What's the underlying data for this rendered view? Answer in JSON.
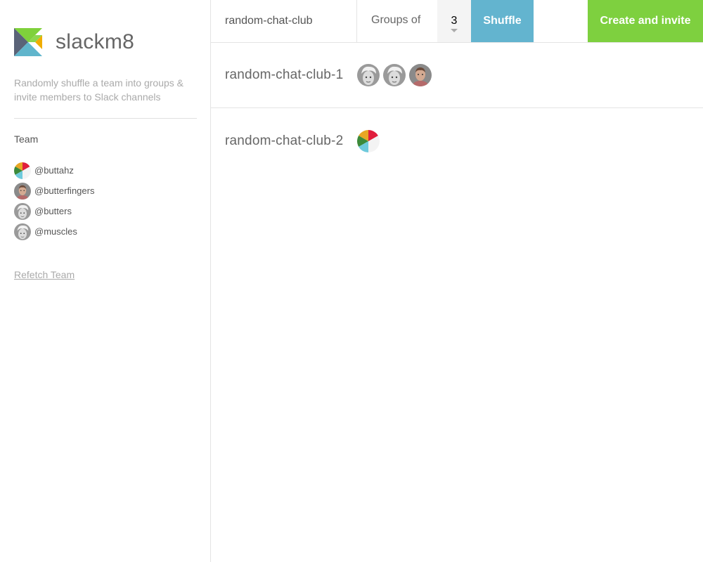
{
  "brand": {
    "name": "slackm8",
    "logo_icon": "elm-tangram-logo-icon"
  },
  "tagline": "Randomly shuffle a team into groups & invite members to Slack channels",
  "team": {
    "title": "Team",
    "members": [
      {
        "handle": "@buttahz",
        "avatar": "buttahz-avatar"
      },
      {
        "handle": "@butterfingers",
        "avatar": "butterfingers-avatar"
      },
      {
        "handle": "@butters",
        "avatar": "butters-avatar"
      },
      {
        "handle": "@muscles",
        "avatar": "muscles-avatar"
      }
    ],
    "refetch_label": "Refetch Team"
  },
  "toolbar": {
    "channel_name": "random-chat-club",
    "groups_of_label": "Groups of",
    "group_size": "3",
    "shuffle_label": "Shuffle",
    "create_label": "Create and invite"
  },
  "groups": [
    {
      "name": "random-chat-club-1",
      "members": [
        "@muscles",
        "@butters",
        "@butterfingers"
      ]
    },
    {
      "name": "random-chat-club-2",
      "members": [
        "@buttahz"
      ]
    }
  ],
  "colors": {
    "shuffle_button": "#63b4cf",
    "create_button": "#7ed03f",
    "logo_green": "#7fd13b",
    "logo_orange": "#f0ad00",
    "logo_blue": "#60b5cc",
    "logo_slate": "#5a6378"
  }
}
